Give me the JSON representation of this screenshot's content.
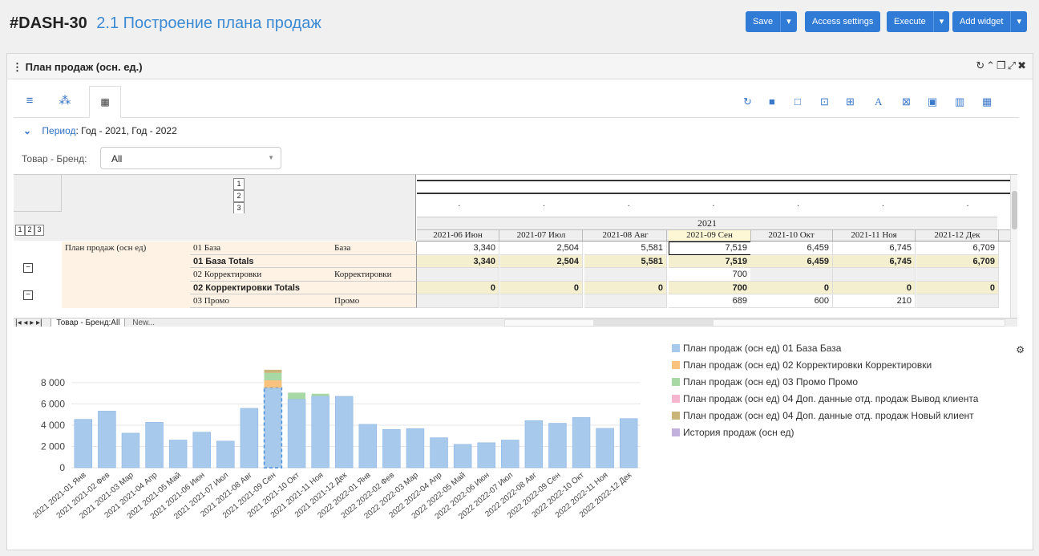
{
  "header": {
    "id": "#DASH-30",
    "title": "2.1 Построение плана продаж",
    "buttons": {
      "save": "Save",
      "access": "Access settings",
      "execute": "Execute",
      "add_widget": "Add widget"
    }
  },
  "widget": {
    "title": "План продаж (осн. ед.)",
    "period_label": "Период",
    "period_value": ": Год - 2021, Год - 2022",
    "filter_label": "Товар - Бренд:",
    "filter_value": "All",
    "sheet_tabs": [
      "Товар - Бренд:All",
      "New..."
    ]
  },
  "grid": {
    "year": "2021",
    "level_buttons": [
      "1",
      "2",
      "3"
    ],
    "col_level_buttons": [
      "1",
      "2",
      "3"
    ],
    "columns": [
      "2021-06 Июн",
      "2021-07 Июл",
      "2021-08 Авг",
      "2021-09 Сен",
      "2021-10 Окт",
      "2021-11 Ноя",
      "2021-12 Дек"
    ],
    "rows": [
      {
        "dim1": "План продаж (осн ед)",
        "dim2": "01 База",
        "dim3": "База",
        "bold": false,
        "values": [
          "3,340",
          "2,504",
          "5,581",
          "7,519",
          "6,459",
          "6,745",
          "6,709"
        ]
      },
      {
        "dim1": "",
        "dim2": "01 База Totals",
        "dim3": "",
        "bold": true,
        "values": [
          "3,340",
          "2,504",
          "5,581",
          "7,519",
          "6,459",
          "6,745",
          "6,709"
        ]
      },
      {
        "dim1": "",
        "dim2": "02 Корректировки",
        "dim3": "Корректировки",
        "bold": false,
        "values": [
          "",
          "",
          "",
          "700",
          "",
          "",
          ""
        ]
      },
      {
        "dim1": "",
        "dim2": "02 Корректировки Totals",
        "dim3": "",
        "bold": true,
        "values": [
          "0",
          "0",
          "0",
          "700",
          "0",
          "0",
          "0"
        ]
      },
      {
        "dim1": "",
        "dim2": "03 Промо",
        "dim3": "Промо",
        "bold": false,
        "values": [
          "",
          "",
          "",
          "689",
          "600",
          "210",
          ""
        ]
      }
    ]
  },
  "chart_data": {
    "type": "bar",
    "categories": [
      "2021 2021-01 Янв",
      "2021 2021-02 Фев",
      "2021 2021-03 Мар",
      "2021 2021-04 Апр",
      "2021 2021-05 Май",
      "2021 2021-06 Июн",
      "2021 2021-07 Июл",
      "2021 2021-08 Авг",
      "2021 2021-09 Сен",
      "2021 2021-10 Окт",
      "2021 2021-11 Ноя",
      "2021 2021-12 Дек",
      "2022 2022-01 Янв",
      "2022 2022-02 Фев",
      "2022 2022-03 Мар",
      "2022 2022-04 Апр",
      "2022 2022-05 Май",
      "2022 2022-06 Июн",
      "2022 2022-07 Июл",
      "2022 2022-08 Авг",
      "2022 2022-09 Сен",
      "2022 2022-10 Окт",
      "2022 2022-11 Ноя",
      "2022 2022-12 Дек"
    ],
    "stacked": true,
    "series": [
      {
        "name": "План продаж (осн ед) 01 База База",
        "color": "#a7c9ec",
        "values": [
          4550,
          5320,
          3250,
          4270,
          2600,
          3340,
          2504,
          5581,
          7519,
          6459,
          6745,
          6709,
          4080,
          3600,
          3680,
          2820,
          2200,
          2350,
          2600,
          4430,
          4180,
          4720,
          3700,
          4620
        ]
      },
      {
        "name": "План продаж (осн ед) 02 Корректировки Корректировки",
        "color": "#f9c37f",
        "values": [
          0,
          0,
          0,
          0,
          0,
          0,
          0,
          0,
          700,
          0,
          0,
          0,
          0,
          0,
          0,
          0,
          0,
          0,
          0,
          0,
          0,
          0,
          0,
          0
        ]
      },
      {
        "name": "План продаж (осн ед) 03 Промо Промо",
        "color": "#a8d9a4",
        "values": [
          0,
          0,
          0,
          0,
          0,
          0,
          0,
          0,
          689,
          600,
          210,
          0,
          0,
          0,
          0,
          0,
          0,
          0,
          0,
          0,
          0,
          0,
          0,
          0
        ]
      },
      {
        "name": "План продаж (осн ед) 04 Доп. данные отд. продаж Вывод клиента",
        "color": "#f5b6cf",
        "values": [
          0,
          0,
          0,
          0,
          0,
          0,
          0,
          0,
          0,
          0,
          0,
          0,
          0,
          0,
          0,
          0,
          0,
          0,
          0,
          0,
          0,
          0,
          0,
          0
        ]
      },
      {
        "name": "План продаж (осн ед) 04 Доп. данные отд. продаж Новый клиент",
        "color": "#c9b47a",
        "values": [
          0,
          0,
          0,
          0,
          0,
          0,
          0,
          0,
          300,
          0,
          0,
          0,
          0,
          0,
          0,
          0,
          0,
          0,
          0,
          0,
          0,
          0,
          0,
          0
        ]
      },
      {
        "name": "История продаж (осн ед)",
        "color": "#c3b1dd",
        "values": [
          0,
          0,
          0,
          0,
          0,
          0,
          0,
          0,
          0,
          0,
          0,
          0,
          0,
          0,
          0,
          0,
          0,
          0,
          0,
          0,
          0,
          0,
          0,
          0
        ]
      }
    ],
    "yticks": [
      "0",
      "2 000",
      "4 000",
      "6 000",
      "8 000"
    ],
    "ylim": [
      0,
      9500
    ],
    "legend": "right",
    "grid": true
  }
}
